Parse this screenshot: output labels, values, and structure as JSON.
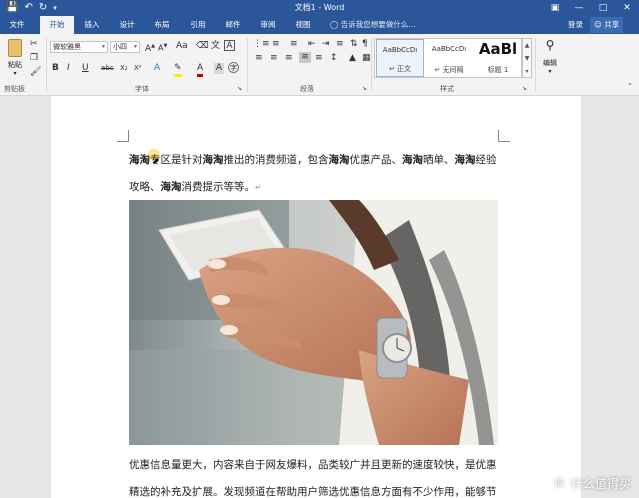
{
  "titlebar": {
    "title": "文档1 - Word",
    "qat_icons": [
      "save-icon",
      "undo-icon",
      "redo-icon",
      "customize-icon"
    ],
    "window_controls": [
      "ribbon-display-icon",
      "minimize-icon",
      "maximize-icon",
      "close-icon"
    ]
  },
  "tabs": [
    {
      "label": "文件"
    },
    {
      "label": "开始",
      "active": true
    },
    {
      "label": "插入"
    },
    {
      "label": "设计"
    },
    {
      "label": "布局"
    },
    {
      "label": "引用"
    },
    {
      "label": "邮件"
    },
    {
      "label": "审阅"
    },
    {
      "label": "视图"
    }
  ],
  "tell_me": "告诉我您想要做什么...",
  "login": "登录",
  "share": "共享",
  "ribbon": {
    "clipboard": {
      "paste_label": "粘贴",
      "group_label": "剪贴板"
    },
    "font": {
      "font_name": "微软雅黑",
      "font_size": "小四",
      "group_label": "字体",
      "buttons": [
        "B",
        "I",
        "U",
        "abc",
        "X₂",
        "X²"
      ]
    },
    "paragraph": {
      "group_label": "段落"
    },
    "styles": {
      "group_label": "样式",
      "items": [
        {
          "preview": "AaBbCcDı",
          "name": "↵ 正文",
          "selected": true
        },
        {
          "preview": "AaBbCcDı",
          "name": "↵ 无间隔"
        },
        {
          "preview": "AaBl",
          "name": "标题 1"
        }
      ]
    },
    "editing": {
      "label": "编辑"
    }
  },
  "document": {
    "line1": {
      "p1": "海淘",
      "p2": "专区是针对",
      "p3": "海淘",
      "p4": "推出的消费频道，包含",
      "p5": "海淘",
      "p6": "优惠产品、",
      "p7": "海淘",
      "p8": "晒单、",
      "p9": "海淘",
      "p10": "经验"
    },
    "line2": {
      "p1": "攻略、",
      "p2": "海淘",
      "p3": "消费提示等等。",
      "p4": "↵"
    },
    "line3": "优惠信息量更大，内容来自于网友爆料，品类较广并且更新的速度较快，是优惠",
    "line4": "精选的补充及扩展。发现频道在帮助用户筛选优惠信息方面有不少作用，能够节"
  },
  "watermark": {
    "text": "什么值得买",
    "logo": "值"
  },
  "colors": {
    "accent": "#2b579a",
    "ribbon_bg": "#f3f3f3"
  }
}
